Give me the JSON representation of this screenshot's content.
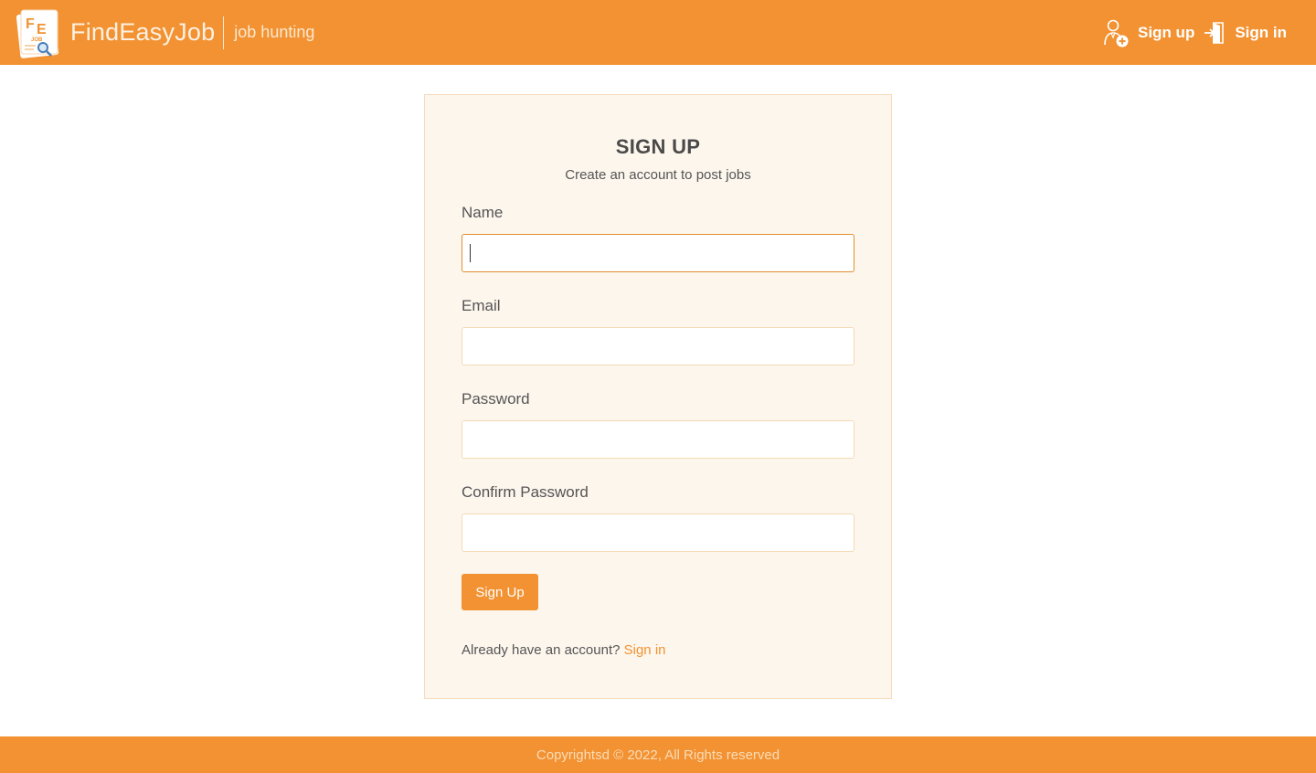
{
  "brand": {
    "logo_letters": "FE",
    "logo_sub": "JOB",
    "name": "FindEasyJob",
    "tagline": "job hunting"
  },
  "nav": {
    "signup_label": "Sign up",
    "signin_label": "Sign in",
    "signup_icon": "add-user-icon",
    "signin_icon": "sign-in-icon"
  },
  "form": {
    "title": "SIGN UP",
    "subtitle": "Create an account to post jobs",
    "fields": [
      {
        "label": "Name",
        "value": "",
        "focused": true
      },
      {
        "label": "Email",
        "value": ""
      },
      {
        "label": "Password",
        "value": ""
      },
      {
        "label": "Confirm Password",
        "value": ""
      }
    ],
    "submit_label": "Sign Up",
    "already_text": "Already have an account?",
    "signin_link": "Sign in"
  },
  "footer": {
    "text": "Copyrightsd © 2022, All Rights reserved"
  },
  "colors": {
    "brand_orange": "#f29232",
    "card_bg": "#fdf6ed",
    "input_border": "#f5d9b4"
  }
}
